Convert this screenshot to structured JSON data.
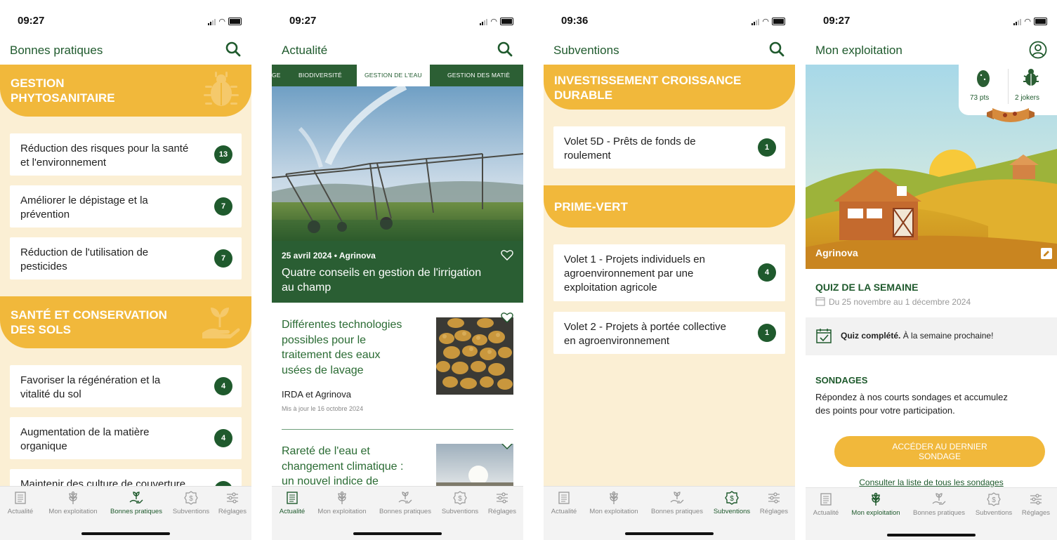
{
  "status": {
    "time1": "09:27",
    "time2": "09:27",
    "time3": "09:36",
    "time4": "09:27"
  },
  "tabs": {
    "actualite": "Actualité",
    "exploitation": "Mon exploitation",
    "pratiques": "Bonnes pratiques",
    "subventions": "Subventions",
    "reglages": "Réglages"
  },
  "screen1": {
    "title": "Bonnes pratiques",
    "sections": [
      {
        "title_l1": "GESTION",
        "title_l2": "PHYTOSANITAIRE",
        "icon": "bug-icon",
        "items": [
          {
            "l1": "Réduction des risques pour la santé",
            "l2": "et l'environnement",
            "count": "13"
          },
          {
            "l1": "Améliorer le dépistage et la",
            "l2": "prévention",
            "count": "7"
          },
          {
            "l1": "Réduction de l'utilisation de",
            "l2": "pesticides",
            "count": "7"
          }
        ]
      },
      {
        "title_l1": "SANTÉ ET CONSERVATION",
        "title_l2": "DES SOLS",
        "icon": "seedling-hand-icon",
        "items": [
          {
            "l1": "Favoriser la régénération et la",
            "l2": "vitalité du sol",
            "count": "4"
          },
          {
            "l1": "Augmentation de la matière",
            "l2": "organique",
            "count": "4"
          },
          {
            "l1": "Maintenir des culture de couverture",
            "l2": "",
            "count": ""
          }
        ]
      }
    ]
  },
  "screen2": {
    "title": "Actualité",
    "chips": [
      "GE",
      "BIODIVERSITÉ",
      "GESTION DE L'EAU",
      "GESTION DES MATIÈ"
    ],
    "featured": {
      "meta": "25 avril 2024  •  Agrinova",
      "title_l1": "Quatre conseils en gestion de l'irrigation",
      "title_l2": "au champ"
    },
    "articles": [
      {
        "title": [
          "Différentes technologies",
          "possibles pour le",
          "traitement des eaux",
          "usées de lavage"
        ],
        "author": "IRDA et Agrinova",
        "updated": "Mis à jour le 16 octobre 2024"
      },
      {
        "title": [
          "Rareté de l'eau et",
          "changement climatique :",
          "un nouvel indice de"
        ],
        "author": "",
        "updated": ""
      }
    ]
  },
  "screen3": {
    "title": "Subventions",
    "sections": [
      {
        "title_l1": "INVESTISSEMENT CROISSANCE",
        "title_l2": "DURABLE",
        "items": [
          {
            "lines": [
              "Volet 5D - Prêts de fonds de",
              "roulement"
            ],
            "count": "1"
          }
        ]
      },
      {
        "title_l1": "PRIME-VERT",
        "title_l2": "",
        "items": [
          {
            "lines": [
              "Volet 1 - Projets individuels en",
              "agroenvironnement par une",
              "exploitation agricole"
            ],
            "count": "4"
          },
          {
            "lines": [
              "Volet 2 - Projets à portée collective",
              "en agroenvironnement"
            ],
            "count": "1"
          }
        ]
      }
    ]
  },
  "screen4": {
    "title": "Mon exploitation",
    "points": "73 pts",
    "jokers": "2 jokers",
    "farm_name": "Agrinova",
    "quiz": {
      "title": "QUIZ DE LA SEMAINE",
      "dates": "Du 25 novembre au 1 décembre 2024",
      "done_bold": "Quiz complété.",
      "done_rest": " À la semaine prochaine!"
    },
    "surveys": {
      "title": "SONDAGES",
      "desc_l1": "Répondez à nos courts sondages et accumulez",
      "desc_l2": "des points pour votre participation.",
      "button_l1": "ACCÉDER AU DERNIER",
      "button_l2": "SONDAGE",
      "link": "Consulter la liste de tous les sondages"
    }
  },
  "colors": {
    "brand_green": "#1f5a2d",
    "accent_yellow": "#f1b83b",
    "cream": "#fbefd4"
  }
}
